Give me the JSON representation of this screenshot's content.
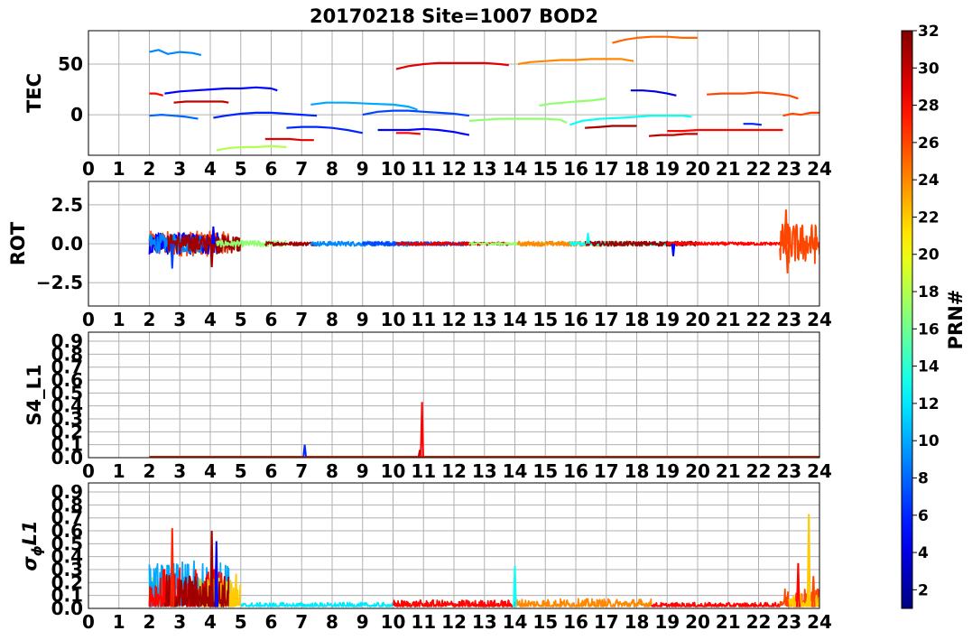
{
  "figure": {
    "title": "20170218 Site=1007 BOD2",
    "colormap": "jet"
  },
  "chart_data": [
    {
      "type": "line",
      "name": "TEC panel",
      "ylabel": "TEC",
      "xlim": [
        0,
        24
      ],
      "ylim": [
        -40,
        83
      ],
      "xticks": [
        "0",
        "1",
        "2",
        "3",
        "4",
        "5",
        "6",
        "7",
        "8",
        "9",
        "10",
        "11",
        "12",
        "13",
        "14",
        "15",
        "16",
        "17",
        "18",
        "19",
        "20",
        "21",
        "22",
        "23",
        "24"
      ],
      "yticks": [
        {
          "v": 50,
          "label": "50"
        },
        {
          "v": 0,
          "label": "0"
        }
      ],
      "grid": true,
      "series": [
        {
          "prn": 9,
          "x": [
            2.0,
            2.3,
            2.6,
            3.0,
            3.4,
            3.7
          ],
          "y": [
            62,
            64,
            60,
            62,
            61,
            59
          ]
        },
        {
          "prn": 28,
          "x": [
            2.0,
            2.2,
            2.45
          ],
          "y": [
            21,
            21,
            19
          ]
        },
        {
          "prn": 5,
          "x": [
            2.5,
            3.0,
            3.5,
            4.0,
            4.5,
            5.0,
            5.5,
            6.0,
            6.2
          ],
          "y": [
            21,
            23,
            24,
            25,
            26,
            26,
            27,
            26,
            24
          ]
        },
        {
          "prn": 30,
          "x": [
            2.8,
            3.2,
            3.6,
            4.0,
            4.4,
            4.6
          ],
          "y": [
            12,
            13,
            13,
            13,
            13,
            12
          ]
        },
        {
          "prn": 8,
          "x": [
            2.0,
            2.4,
            2.8,
            3.2,
            3.6
          ],
          "y": [
            -1,
            0,
            -1,
            -2,
            -4
          ]
        },
        {
          "prn": 6,
          "x": [
            4.1,
            4.5,
            5.0,
            5.5,
            6.0,
            6.5,
            7.0,
            7.5
          ],
          "y": [
            -3,
            -1,
            1,
            2,
            2,
            1,
            0,
            -1
          ]
        },
        {
          "prn": 18,
          "x": [
            4.2,
            4.6,
            5.0,
            5.5,
            6.0,
            6.5
          ],
          "y": [
            -35,
            -33,
            -32,
            -32,
            -31,
            -32
          ]
        },
        {
          "prn": 29,
          "x": [
            5.8,
            6.2,
            6.6,
            7.0,
            7.4
          ],
          "y": [
            -24,
            -24,
            -24,
            -25,
            -25
          ]
        },
        {
          "prn": 6,
          "x": [
            6.5,
            7.0,
            7.5,
            8.0,
            8.5,
            9.0
          ],
          "y": [
            -13,
            -12,
            -12,
            -13,
            -15,
            -18
          ]
        },
        {
          "prn": 10,
          "x": [
            7.3,
            7.8,
            8.5,
            9.2,
            10.0,
            10.5,
            10.8
          ],
          "y": [
            10,
            12,
            12,
            11,
            10,
            8,
            5
          ]
        },
        {
          "prn": 7,
          "x": [
            9.0,
            9.5,
            10.0,
            10.5,
            11.0,
            11.5,
            12.0,
            12.5
          ],
          "y": [
            0,
            3,
            4,
            4,
            3,
            2,
            1,
            -1
          ]
        },
        {
          "prn": 5,
          "x": [
            9.5,
            10.0,
            10.5,
            11.0,
            11.5,
            12.0,
            12.5
          ],
          "y": [
            -15,
            -15,
            -15,
            -14,
            -15,
            -17,
            -20
          ]
        },
        {
          "prn": 28,
          "x": [
            10.1,
            10.5,
            10.9
          ],
          "y": [
            -18,
            -18,
            -19
          ]
        },
        {
          "prn": 29,
          "x": [
            10.1,
            10.5,
            11.0,
            11.5,
            12.0,
            12.5,
            13.0,
            13.5,
            13.8
          ],
          "y": [
            45,
            48,
            50,
            51,
            51,
            51,
            51,
            50,
            49
          ]
        },
        {
          "prn": 17,
          "x": [
            12.5,
            13.0,
            13.5,
            14.0,
            14.5,
            15.0,
            15.5,
            15.7
          ],
          "y": [
            -6,
            -5,
            -4,
            -4,
            -4,
            -4,
            -5,
            -8
          ]
        },
        {
          "prn": 24,
          "x": [
            14.1,
            14.5,
            15.0,
            15.5,
            16.0,
            16.5,
            17.0,
            17.5,
            17.9
          ],
          "y": [
            50,
            52,
            53,
            54,
            54,
            55,
            55,
            55,
            53
          ]
        },
        {
          "prn": 17,
          "x": [
            14.8,
            15.2,
            15.6,
            16.0,
            16.5,
            17.0
          ],
          "y": [
            9,
            11,
            12,
            13,
            14,
            16
          ]
        },
        {
          "prn": 13,
          "x": [
            15.8,
            16.2,
            16.8,
            17.5,
            18.0,
            18.5,
            19.0,
            19.5,
            19.8
          ],
          "y": [
            -10,
            -6,
            -4,
            -3,
            -2,
            -1,
            -1,
            -1,
            -2
          ]
        },
        {
          "prn": 25,
          "x": [
            17.2,
            17.6,
            18.0,
            18.5,
            19.0,
            19.5,
            20.0
          ],
          "y": [
            71,
            74,
            76,
            77,
            77,
            76,
            76
          ]
        },
        {
          "prn": 31,
          "x": [
            16.3,
            16.8,
            17.2,
            17.6,
            18.0
          ],
          "y": [
            -13,
            -12,
            -11,
            -11,
            -11
          ]
        },
        {
          "prn": 4,
          "x": [
            17.8,
            18.2,
            18.6,
            19.0,
            19.3
          ],
          "y": [
            24,
            24,
            23,
            21,
            19
          ]
        },
        {
          "prn": 30,
          "x": [
            18.4,
            18.8,
            19.2,
            19.6,
            20.0
          ],
          "y": [
            -21,
            -20,
            -20,
            -19,
            -19
          ]
        },
        {
          "prn": 28,
          "x": [
            19.0,
            19.5,
            20.0,
            20.5,
            21.0,
            21.5,
            22.0,
            22.5,
            22.8
          ],
          "y": [
            -16,
            -16,
            -15,
            -15,
            -15,
            -15,
            -15,
            -15,
            -15
          ]
        },
        {
          "prn": 26,
          "x": [
            20.3,
            20.8,
            21.5,
            22.0,
            22.5,
            23.0,
            23.3
          ],
          "y": [
            20,
            21,
            21,
            22,
            21,
            19,
            16
          ]
        },
        {
          "prn": 6,
          "x": [
            21.5,
            21.8,
            22.1
          ],
          "y": [
            -9,
            -9,
            -10
          ]
        },
        {
          "prn": 26,
          "x": [
            22.8,
            23.1,
            23.4,
            23.7,
            24.0
          ],
          "y": [
            -1,
            1,
            0,
            2,
            2
          ]
        }
      ]
    },
    {
      "type": "line",
      "name": "ROT panel",
      "ylabel": "ROT",
      "xlim": [
        0,
        24
      ],
      "ylim": [
        -4,
        4
      ],
      "yticks": [
        {
          "v": 2.5,
          "label": "2.5"
        },
        {
          "v": 0,
          "label": "0.0"
        },
        {
          "v": -2.5,
          "label": "−2.5"
        }
      ],
      "grid": true,
      "noisy_segments": [
        {
          "prn": 26,
          "x0": 2.0,
          "x1": 4.6,
          "amp": 0.8
        },
        {
          "prn": 5,
          "x0": 2.0,
          "x1": 4.3,
          "amp": 0.7
        },
        {
          "prn": 9,
          "x0": 2.0,
          "x1": 3.7,
          "amp": 0.6
        },
        {
          "prn": 31,
          "x0": 2.6,
          "x1": 5.0,
          "amp": 0.6
        },
        {
          "prn": 17,
          "x0": 4.2,
          "x1": 6.5,
          "amp": 0.2
        },
        {
          "prn": 31,
          "x0": 5.8,
          "x1": 7.5,
          "amp": 0.12
        },
        {
          "prn": 9,
          "x0": 7.3,
          "x1": 10.8,
          "amp": 0.15
        },
        {
          "prn": 7,
          "x0": 9.0,
          "x1": 12.5,
          "amp": 0.12
        },
        {
          "prn": 29,
          "x0": 10.1,
          "x1": 13.8,
          "amp": 0.1
        },
        {
          "prn": 17,
          "x0": 12.5,
          "x1": 15.7,
          "amp": 0.08
        },
        {
          "prn": 24,
          "x0": 14.1,
          "x1": 17.9,
          "amp": 0.15
        },
        {
          "prn": 13,
          "x0": 15.8,
          "x1": 19.8,
          "amp": 0.12
        },
        {
          "prn": 31,
          "x0": 16.3,
          "x1": 20.0,
          "amp": 0.15
        },
        {
          "prn": 28,
          "x0": 19.0,
          "x1": 22.8,
          "amp": 0.1
        },
        {
          "prn": 26,
          "x0": 22.7,
          "x1": 24.0,
          "amp": 1.3
        }
      ],
      "spikes": [
        {
          "prn": 7,
          "x": 2.75,
          "y": -1.6
        },
        {
          "prn": 31,
          "x": 4.05,
          "y": -1.5
        },
        {
          "prn": 5,
          "x": 4.1,
          "y": 1.1
        },
        {
          "prn": 13,
          "x": 16.4,
          "y": 0.7
        },
        {
          "prn": 5,
          "x": 19.2,
          "y": -0.8
        },
        {
          "prn": 26,
          "x": 22.9,
          "y": 2.2
        },
        {
          "prn": 26,
          "x": 22.95,
          "y": -1.9
        }
      ]
    },
    {
      "type": "line",
      "name": "S4_L1 panel",
      "ylabel": "S4_L1",
      "xlim": [
        0,
        24
      ],
      "ylim": [
        0.0,
        0.97
      ],
      "yticks": [
        {
          "v": 0.0,
          "label": "0.0"
        },
        {
          "v": 0.1,
          "label": "0.1"
        },
        {
          "v": 0.2,
          "label": "0.2"
        },
        {
          "v": 0.3,
          "label": "0.3"
        },
        {
          "v": 0.4,
          "label": "0.4"
        },
        {
          "v": 0.5,
          "label": "0.5"
        },
        {
          "v": 0.6,
          "label": "0.6"
        },
        {
          "v": 0.7,
          "label": "0.7"
        },
        {
          "v": 0.8,
          "label": "0.8"
        },
        {
          "v": 0.9,
          "label": "0.9"
        }
      ],
      "grid": true,
      "baseline": {
        "x0": 2.0,
        "x1": 24.0,
        "y": 0.005
      },
      "spikes": [
        {
          "prn": 6,
          "x": 7.1,
          "y": 0.1
        },
        {
          "prn": 30,
          "x": 10.88,
          "y": 0.06
        },
        {
          "prn": 28,
          "x": 10.95,
          "y": 0.43
        }
      ]
    },
    {
      "type": "line",
      "name": "sigma_phi L1 panel",
      "ylabel": "σ",
      "ylabel_sub": "ϕ",
      "ylabel_tail": "L1",
      "xlim": [
        0,
        24
      ],
      "ylim": [
        0.0,
        0.97
      ],
      "yticks": [
        {
          "v": 0.0,
          "label": "0.0"
        },
        {
          "v": 0.1,
          "label": "0.1"
        },
        {
          "v": 0.2,
          "label": "0.2"
        },
        {
          "v": 0.3,
          "label": "0.3"
        },
        {
          "v": 0.4,
          "label": "0.4"
        },
        {
          "v": 0.5,
          "label": "0.5"
        },
        {
          "v": 0.6,
          "label": "0.6"
        },
        {
          "v": 0.7,
          "label": "0.7"
        },
        {
          "v": 0.8,
          "label": "0.8"
        },
        {
          "v": 0.9,
          "label": "0.9"
        }
      ],
      "grid": true,
      "noisy_segments": [
        {
          "prn": 18,
          "x0": 2.0,
          "x1": 3.0,
          "amp": 0.25
        },
        {
          "prn": 10,
          "x0": 2.0,
          "x1": 4.7,
          "amp": 0.35
        },
        {
          "prn": 28,
          "x0": 2.0,
          "x1": 4.5,
          "amp": 0.3
        },
        {
          "prn": 22,
          "x0": 3.6,
          "x1": 5.0,
          "amp": 0.25
        },
        {
          "prn": 31,
          "x0": 2.5,
          "x1": 4.6,
          "amp": 0.25
        },
        {
          "prn": 12,
          "x0": 5.0,
          "x1": 10.0,
          "amp": 0.03
        },
        {
          "prn": 28,
          "x0": 10.0,
          "x1": 14.0,
          "amp": 0.05
        },
        {
          "prn": 24,
          "x0": 14.0,
          "x1": 18.5,
          "amp": 0.06
        },
        {
          "prn": 28,
          "x0": 18.5,
          "x1": 22.7,
          "amp": 0.03
        },
        {
          "prn": 26,
          "x0": 22.7,
          "x1": 24.0,
          "amp": 0.15
        },
        {
          "prn": 22,
          "x0": 23.0,
          "x1": 24.0,
          "amp": 0.1
        }
      ],
      "spikes": [
        {
          "prn": 27,
          "x": 2.75,
          "y": 0.62
        },
        {
          "prn": 31,
          "x": 4.05,
          "y": 0.6
        },
        {
          "prn": 5,
          "x": 4.2,
          "y": 0.52
        },
        {
          "prn": 13,
          "x": 14.0,
          "y": 0.33
        },
        {
          "prn": 28,
          "x": 23.3,
          "y": 0.35
        },
        {
          "prn": 22,
          "x": 23.65,
          "y": 0.73
        },
        {
          "prn": 26,
          "x": 23.8,
          "y": 0.25
        }
      ]
    }
  ],
  "colorbar": {
    "label": "PRN#",
    "min": 1,
    "max": 32,
    "ticks": [
      {
        "v": 2,
        "label": "2"
      },
      {
        "v": 4,
        "label": "4"
      },
      {
        "v": 6,
        "label": "6"
      },
      {
        "v": 8,
        "label": "8"
      },
      {
        "v": 10,
        "label": "10"
      },
      {
        "v": 12,
        "label": "12"
      },
      {
        "v": 14,
        "label": "14"
      },
      {
        "v": 16,
        "label": "16"
      },
      {
        "v": 18,
        "label": "18"
      },
      {
        "v": 20,
        "label": "20"
      },
      {
        "v": 22,
        "label": "22"
      },
      {
        "v": 24,
        "label": "24"
      },
      {
        "v": 26,
        "label": "26"
      },
      {
        "v": 28,
        "label": "28"
      },
      {
        "v": 30,
        "label": "30"
      },
      {
        "v": 32,
        "label": "32"
      }
    ]
  }
}
